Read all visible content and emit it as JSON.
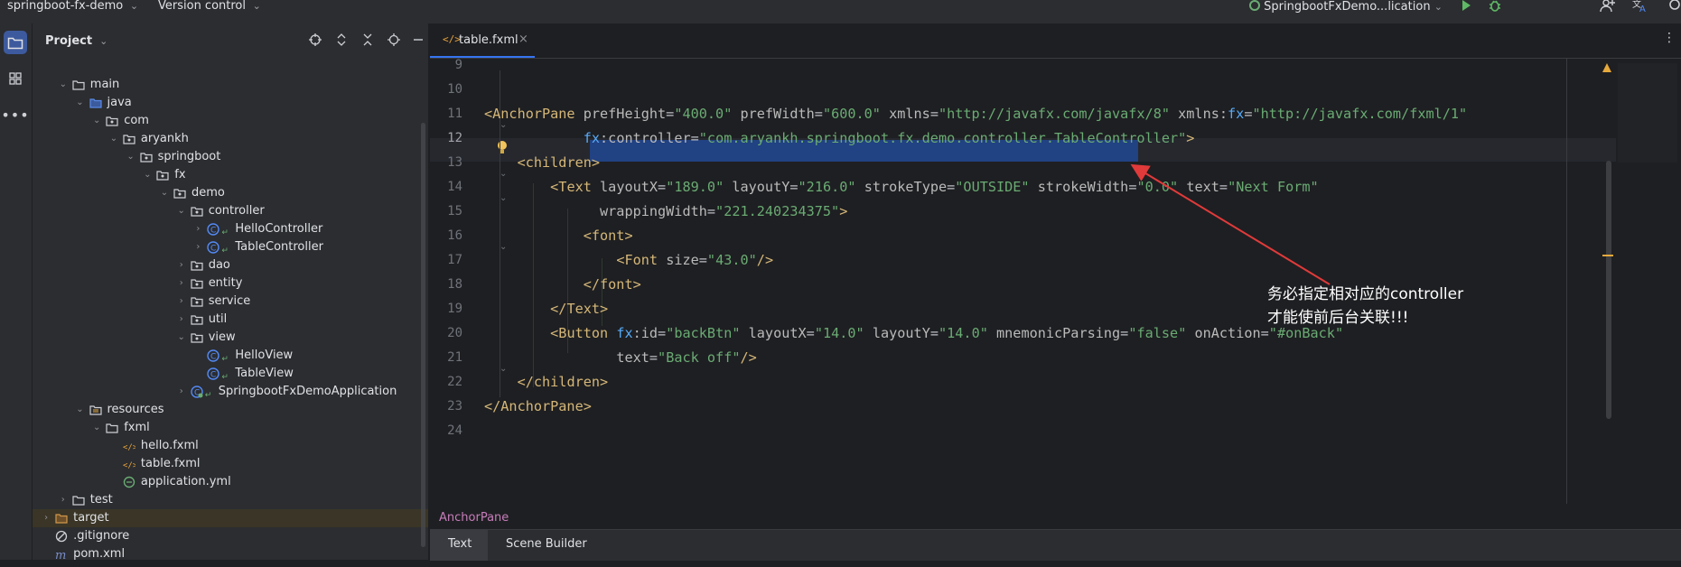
{
  "titlebar": {
    "project_name": "springboot-fx-demo",
    "vcs_label": "Version control",
    "run_config": "SpringbootFxDemo...lication"
  },
  "project_panel": {
    "title": "Project",
    "tree": [
      {
        "label": "main",
        "indent": 4,
        "type": "folder",
        "expanded": true
      },
      {
        "label": "java",
        "indent": 5,
        "type": "src-folder",
        "expanded": true
      },
      {
        "label": "com",
        "indent": 6,
        "type": "package",
        "expanded": true
      },
      {
        "label": "aryankh",
        "indent": 7,
        "type": "package",
        "expanded": true
      },
      {
        "label": "springboot",
        "indent": 8,
        "type": "package",
        "expanded": true
      },
      {
        "label": "fx",
        "indent": 9,
        "type": "package",
        "expanded": true
      },
      {
        "label": "demo",
        "indent": 10,
        "type": "package",
        "expanded": true
      },
      {
        "label": "controller",
        "indent": 11,
        "type": "package",
        "expanded": true
      },
      {
        "label": "HelloController",
        "indent": 12,
        "type": "class",
        "expanded": false
      },
      {
        "label": "TableController",
        "indent": 12,
        "type": "class",
        "expanded": false
      },
      {
        "label": "dao",
        "indent": 11,
        "type": "package",
        "expanded": false
      },
      {
        "label": "entity",
        "indent": 11,
        "type": "package",
        "expanded": false
      },
      {
        "label": "service",
        "indent": 11,
        "type": "package",
        "expanded": false
      },
      {
        "label": "util",
        "indent": 11,
        "type": "package",
        "expanded": false
      },
      {
        "label": "view",
        "indent": 11,
        "type": "package",
        "expanded": true
      },
      {
        "label": "HelloView",
        "indent": 12,
        "type": "class-leaf"
      },
      {
        "label": "TableView",
        "indent": 12,
        "type": "class-leaf"
      },
      {
        "label": "SpringbootFxDemoApplication",
        "indent": 11,
        "type": "app-class",
        "expanded": false
      },
      {
        "label": "resources",
        "indent": 5,
        "type": "res-folder",
        "expanded": true
      },
      {
        "label": "fxml",
        "indent": 6,
        "type": "folder",
        "expanded": true
      },
      {
        "label": "hello.fxml",
        "indent": 7,
        "type": "fxml"
      },
      {
        "label": "table.fxml",
        "indent": 7,
        "type": "fxml",
        "selected": true
      },
      {
        "label": "application.yml",
        "indent": 7,
        "type": "yml"
      },
      {
        "label": "test",
        "indent": 4,
        "type": "folder",
        "expanded": false
      },
      {
        "label": "target",
        "indent": 3,
        "type": "target-folder",
        "expanded": false
      },
      {
        "label": ".gitignore",
        "indent": 3,
        "type": "ignore"
      },
      {
        "label": "pom.xml",
        "indent": 3,
        "type": "maven"
      }
    ]
  },
  "editor": {
    "tab_label": "table.fxml",
    "line_numbers": [
      "9",
      "10",
      "11",
      "12",
      "13",
      "14",
      "15",
      "16",
      "17",
      "18",
      "19",
      "20",
      "21",
      "22",
      "23",
      "24"
    ],
    "current_line": "12",
    "breadcrumb": "AnchorPane",
    "bottom_tabs": [
      "Text",
      "Scene Builder"
    ],
    "code_lines": [
      {
        "parts": []
      },
      {
        "parts": []
      },
      {
        "parts": [
          [
            "tag",
            "<AnchorPane "
          ],
          [
            "attr",
            "prefHeight"
          ],
          [
            "punc",
            "="
          ],
          [
            "val",
            "\"400.0\" "
          ],
          [
            "attr",
            "prefWidth"
          ],
          [
            "punc",
            "="
          ],
          [
            "val",
            "\"600.0\" "
          ],
          [
            "attr",
            "xmlns"
          ],
          [
            "punc",
            "="
          ],
          [
            "val",
            "\"http://javafx.com/javafx/8\" "
          ],
          [
            "attr",
            "xmlns:"
          ],
          [
            "ns",
            "fx"
          ],
          [
            "punc",
            "="
          ],
          [
            "val",
            "\"http://javafx.com/fxml/1\""
          ]
        ]
      },
      {
        "parts": [
          [
            "pad",
            "            "
          ],
          [
            "ns",
            "fx"
          ],
          [
            "attr",
            ":controller"
          ],
          [
            "punc",
            "="
          ],
          [
            "val",
            "\"com.aryankh.springboot.fx.demo.controller.TableController\""
          ],
          [
            "tag",
            ">"
          ]
        ]
      },
      {
        "parts": [
          [
            "pad",
            "    "
          ],
          [
            "tag",
            "<children>"
          ]
        ]
      },
      {
        "parts": [
          [
            "pad",
            "        "
          ],
          [
            "tag",
            "<Text "
          ],
          [
            "attr",
            "layoutX"
          ],
          [
            "punc",
            "="
          ],
          [
            "val",
            "\"189.0\" "
          ],
          [
            "attr",
            "layoutY"
          ],
          [
            "punc",
            "="
          ],
          [
            "val",
            "\"216.0\" "
          ],
          [
            "attr",
            "strokeType"
          ],
          [
            "punc",
            "="
          ],
          [
            "val",
            "\"OUTSIDE\" "
          ],
          [
            "attr",
            "strokeWidth"
          ],
          [
            "punc",
            "="
          ],
          [
            "val",
            "\"0.0\" "
          ],
          [
            "attr",
            "text"
          ],
          [
            "punc",
            "="
          ],
          [
            "val",
            "\"Next Form\""
          ]
        ]
      },
      {
        "parts": [
          [
            "pad",
            "              "
          ],
          [
            "attr",
            "wrappingWidth"
          ],
          [
            "punc",
            "="
          ],
          [
            "val",
            "\"221.240234375\""
          ],
          [
            "tag",
            ">"
          ]
        ]
      },
      {
        "parts": [
          [
            "pad",
            "            "
          ],
          [
            "tag",
            "<font>"
          ]
        ]
      },
      {
        "parts": [
          [
            "pad",
            "                "
          ],
          [
            "tag",
            "<Font "
          ],
          [
            "attr",
            "size"
          ],
          [
            "punc",
            "="
          ],
          [
            "val",
            "\"43.0\""
          ],
          [
            "tag",
            "/>"
          ]
        ]
      },
      {
        "parts": [
          [
            "pad",
            "            "
          ],
          [
            "tag",
            "</font>"
          ]
        ]
      },
      {
        "parts": [
          [
            "pad",
            "        "
          ],
          [
            "tag",
            "</Text>"
          ]
        ]
      },
      {
        "parts": [
          [
            "pad",
            "        "
          ],
          [
            "tag",
            "<Button "
          ],
          [
            "ns",
            "fx"
          ],
          [
            "attr",
            ":id"
          ],
          [
            "punc",
            "="
          ],
          [
            "val",
            "\"backBtn\" "
          ],
          [
            "attr",
            "layoutX"
          ],
          [
            "punc",
            "="
          ],
          [
            "val",
            "\"14.0\" "
          ],
          [
            "attr",
            "layoutY"
          ],
          [
            "punc",
            "="
          ],
          [
            "val",
            "\"14.0\" "
          ],
          [
            "attr",
            "mnemonicParsing"
          ],
          [
            "punc",
            "="
          ],
          [
            "val",
            "\"false\" "
          ],
          [
            "attr",
            "onAction"
          ],
          [
            "punc",
            "="
          ],
          [
            "val",
            "\"#onBack\""
          ]
        ]
      },
      {
        "parts": [
          [
            "pad",
            "                "
          ],
          [
            "attr",
            "text"
          ],
          [
            "punc",
            "="
          ],
          [
            "val",
            "\"Back off\""
          ],
          [
            "tag",
            "/>"
          ]
        ]
      },
      {
        "parts": [
          [
            "pad",
            "    "
          ],
          [
            "tag",
            "</children>"
          ]
        ]
      },
      {
        "parts": [
          [
            "tag",
            "</AnchorPane>"
          ]
        ]
      },
      {
        "parts": []
      }
    ]
  },
  "annotation": {
    "line1": "务必指定相对应的controller",
    "line2": "才能使前后台关联!!!"
  },
  "colors": {
    "accent": "#3574f0",
    "arrow": "#e03a3a",
    "selection": "#214283"
  }
}
